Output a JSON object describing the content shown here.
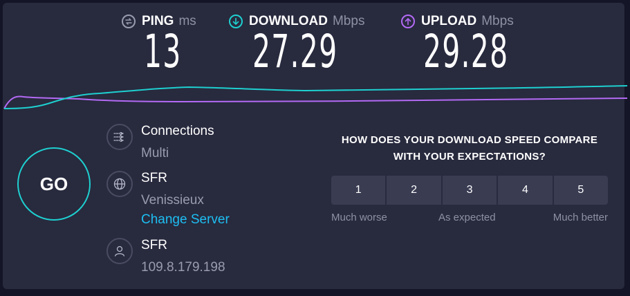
{
  "metrics": {
    "ping": {
      "label": "PING",
      "unit": "ms",
      "value": "13",
      "icon": "ping-icon",
      "color": "#9a9cae"
    },
    "download": {
      "label": "DOWNLOAD",
      "unit": "Mbps",
      "value": "27.29",
      "icon": "download-arrow-icon",
      "color": "#1ed0d0"
    },
    "upload": {
      "label": "UPLOAD",
      "unit": "Mbps",
      "value": "29.28",
      "icon": "upload-arrow-icon",
      "color": "#b36af5"
    }
  },
  "go_button": {
    "label": "GO"
  },
  "connections": {
    "title": "Connections",
    "value": "Multi",
    "icon": "connections-icon"
  },
  "server": {
    "provider": "SFR",
    "location": "Venissieux",
    "change_label": "Change Server",
    "icon": "globe-icon"
  },
  "user": {
    "provider": "SFR",
    "ip": "109.8.179.198",
    "icon": "user-icon"
  },
  "survey": {
    "question_line1": "HOW DOES YOUR DOWNLOAD SPEED COMPARE",
    "question_line2": "WITH YOUR EXPECTATIONS?",
    "options": [
      "1",
      "2",
      "3",
      "4",
      "5"
    ],
    "scale_low": "Much worse",
    "scale_mid": "As expected",
    "scale_high": "Much better"
  }
}
